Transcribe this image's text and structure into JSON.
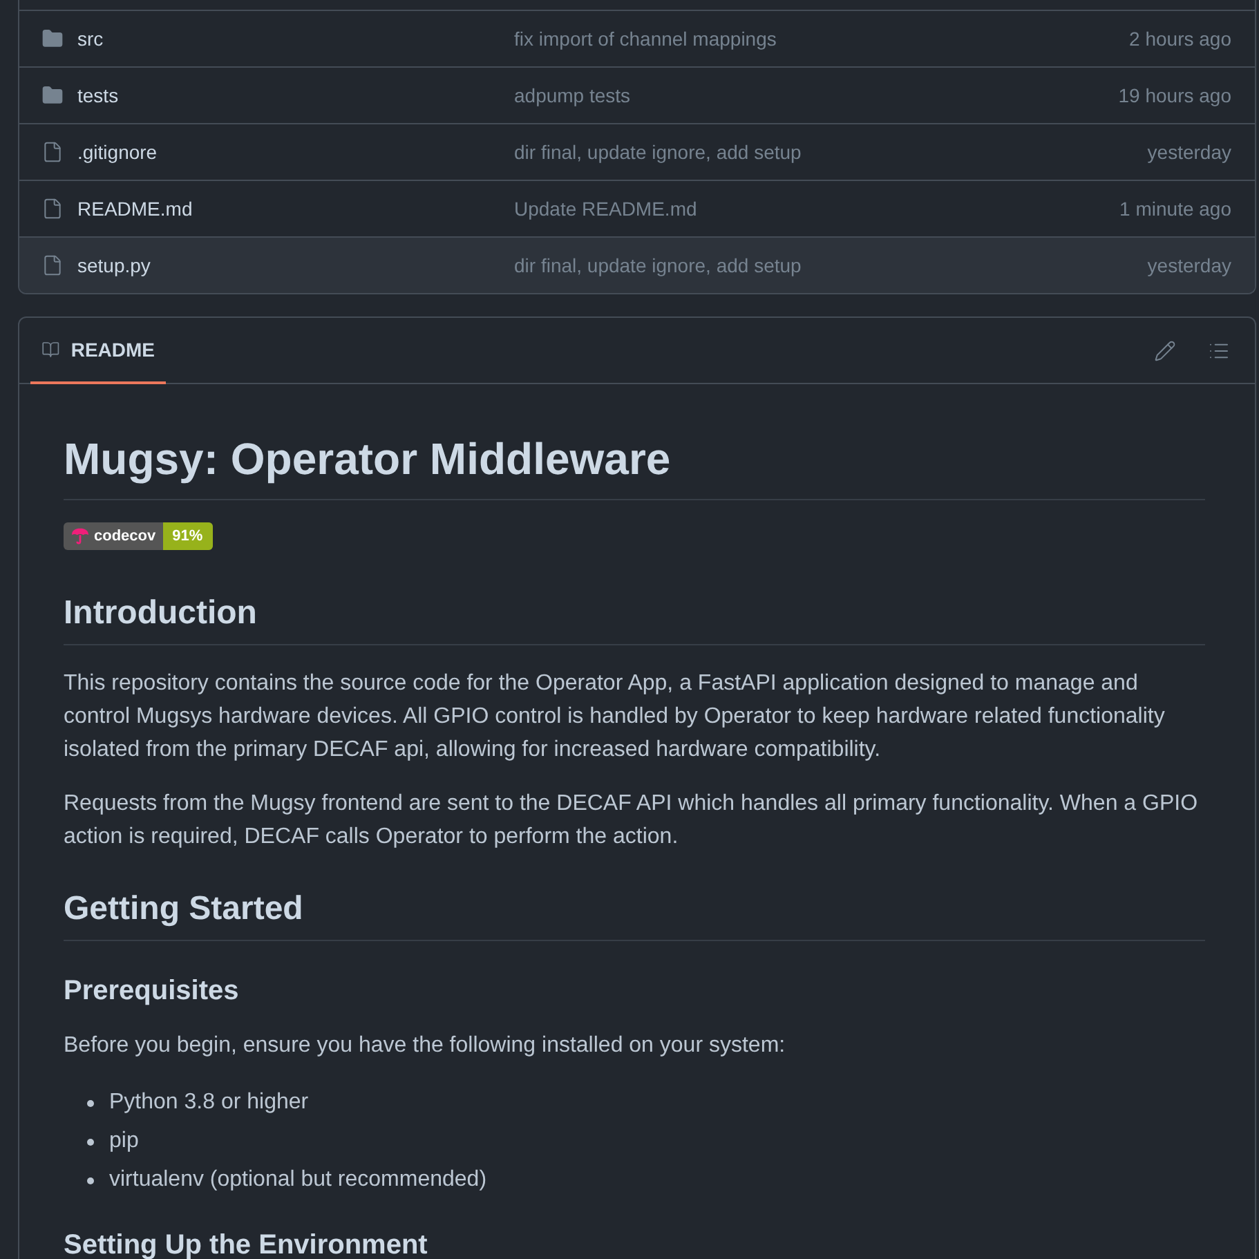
{
  "files": [
    {
      "kind": "folder",
      "name": "src",
      "message": "fix import of channel mappings",
      "time": "2 hours ago",
      "highlighted": false
    },
    {
      "kind": "folder",
      "name": "tests",
      "message": "adpump tests",
      "time": "19 hours ago",
      "highlighted": false
    },
    {
      "kind": "file",
      "name": ".gitignore",
      "message": "dir final, update ignore, add setup",
      "time": "yesterday",
      "highlighted": false
    },
    {
      "kind": "file",
      "name": "README.md",
      "message": "Update README.md",
      "time": "1 minute ago",
      "highlighted": false
    },
    {
      "kind": "file",
      "name": "setup.py",
      "message": "dir final, update ignore, add setup",
      "time": "yesterday",
      "highlighted": true
    }
  ],
  "readme": {
    "tab": {
      "label": "README",
      "selected": true
    },
    "content": [
      {
        "kind": "h1",
        "text": "Mugsy: Operator Middleware"
      },
      {
        "kind": "badge",
        "label": "codecov",
        "value": "91%"
      },
      {
        "kind": "h2",
        "text": "Introduction"
      },
      {
        "kind": "p",
        "text": "This repository contains the source code for the Operator App, a FastAPI application designed to manage and control Mugsys hardware devices. All GPIO control is handled by Operator to keep hardware related functionality isolated from the primary DECAF api, allowing for increased hardware compatibility."
      },
      {
        "kind": "p",
        "text": "Requests from the Mugsy frontend are sent to the DECAF API which handles all primary functionality. When a GPIO action is required, DECAF calls Operator to perform the action."
      },
      {
        "kind": "h2",
        "text": "Getting Started"
      },
      {
        "kind": "h3",
        "text": "Prerequisites"
      },
      {
        "kind": "p",
        "text": "Before you begin, ensure you have the following installed on your system:"
      },
      {
        "kind": "ul",
        "items": [
          "Python 3.8 or higher",
          "pip",
          "virtualenv (optional but recommended)"
        ]
      },
      {
        "kind": "h3",
        "text": "Setting Up the Environment"
      }
    ]
  }
}
